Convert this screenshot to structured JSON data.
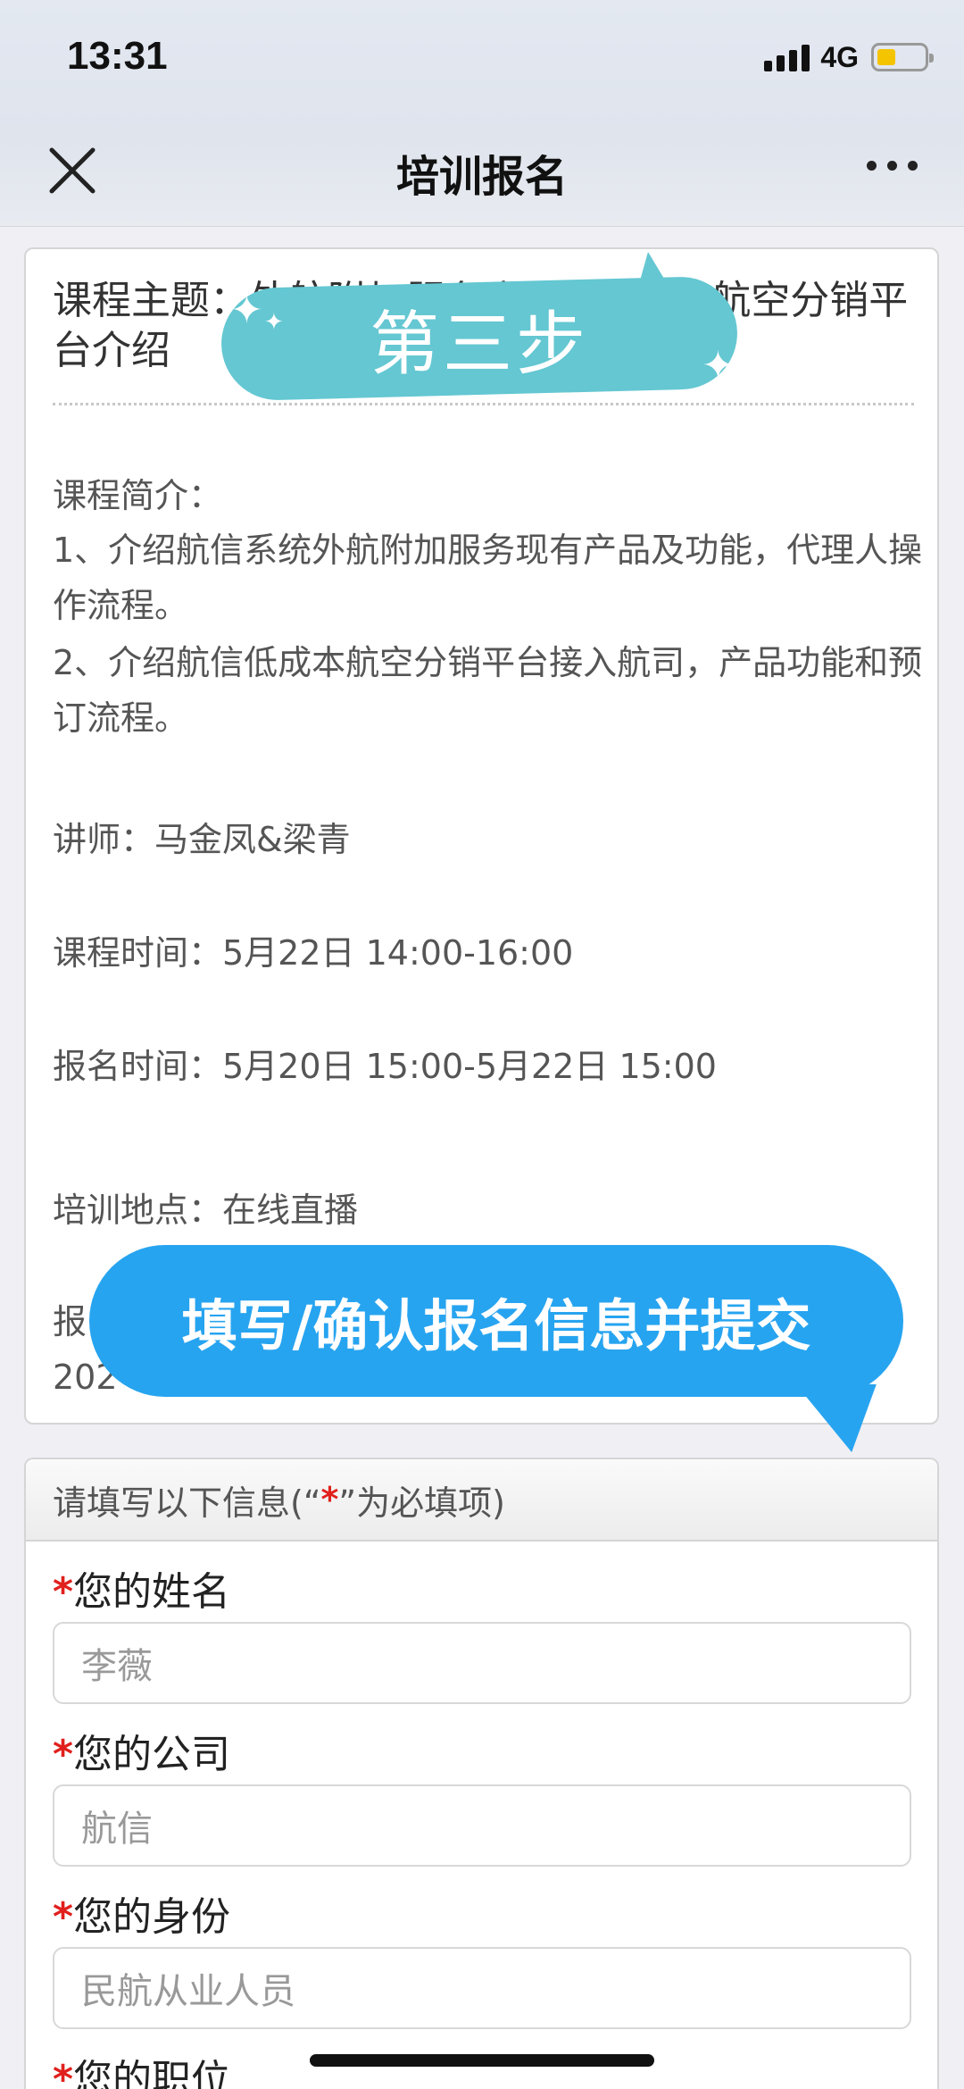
{
  "status_bar": {
    "time": "13:31",
    "network": "4G"
  },
  "header": {
    "title": "培训报名"
  },
  "course": {
    "subject": "课程主题：外航附加服务产品&低成本航空分销平台介绍",
    "intro_label": "课程简介：",
    "intro_line1": "1、介绍航信系统外航附加服务现有产品及功能，代理人操作流程。",
    "intro_line2": "2、介绍航信低成本航空分销平台接入航司，产品功能和预订流程。",
    "lecturer": "讲师：马金凤&梁青",
    "course_time": "课程时间：5月22日 14:00-16:00",
    "signup_time": "报名时间：5月20日 15:00-5月22日 15:00",
    "location": "培训地点：在线直播",
    "partial_line1": "报",
    "partial_line2": "202"
  },
  "overlays": {
    "step_label": "第三步",
    "bubble_text": "填写/确认报名信息并提交"
  },
  "form": {
    "header_prefix": "请填写以下信息(“",
    "header_star": "*",
    "header_suffix": "”为必填项)",
    "required_mark": "*",
    "fields": [
      {
        "label": "您的姓名",
        "value": "李薇"
      },
      {
        "label": "您的公司",
        "value": "航信"
      },
      {
        "label": "您的身份",
        "value": "民航从业人员"
      },
      {
        "label": "您的职位",
        "value": ""
      }
    ]
  },
  "colors": {
    "step_blob": "#64c7d2",
    "bubble": "#27a4f0",
    "required": "#e0201c",
    "battery": "#f5c400"
  }
}
